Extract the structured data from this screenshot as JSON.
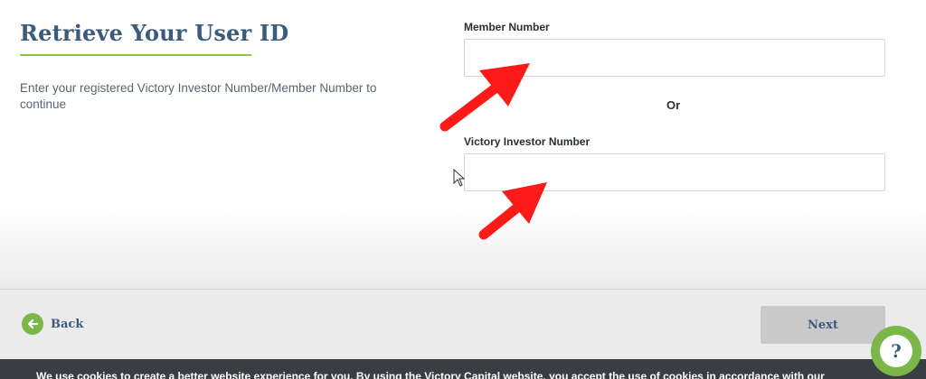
{
  "page": {
    "title": "Retrieve Your User ID",
    "intro": "Enter your registered Victory Investor Number/Member Number to continue"
  },
  "form": {
    "member_number_label": "Member Number",
    "member_number_value": "",
    "or_text": "Or",
    "investor_number_label": "Victory Investor Number",
    "investor_number_value": ""
  },
  "footer": {
    "back_label": "Back",
    "next_label": "Next"
  },
  "cookie_banner": {
    "text": "We use cookies to create a better website experience for you. By using the Victory Capital website, you accept the use of cookies in accordance with our"
  },
  "help": {
    "label": "?"
  },
  "colors": {
    "brand_green": "#7ab648",
    "title_blue": "#3b5b7a",
    "annotation_red": "#ff1a1a",
    "cookie_bg": "#3a3d41"
  },
  "icons": [
    "arrow-left-icon",
    "question-icon",
    "mouse-cursor-icon",
    "red-arrow-annotation"
  ]
}
